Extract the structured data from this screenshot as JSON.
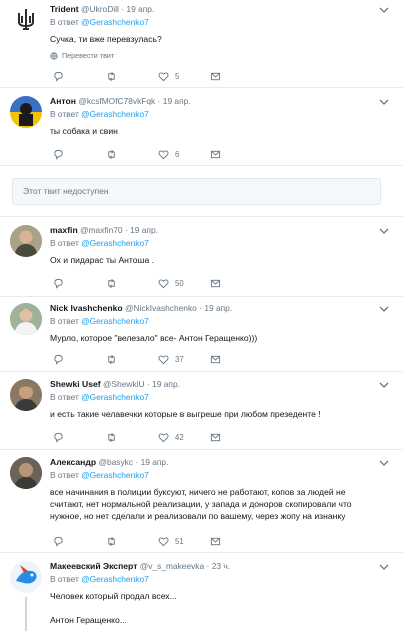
{
  "reply_prefix": "В ответ",
  "translate_label": "Перевести твит",
  "unavailable_text": "Этот твит недоступен",
  "tweets": [
    {
      "name": "Trident",
      "handle": "@UkroDill",
      "date": "19 апр.",
      "mention": "@Gerashchenko7",
      "text": "Сучка, ти вже перевзулась?",
      "replies": "",
      "retweets": "",
      "likes": "5"
    },
    {
      "name": "Антон",
      "handle": "@kcsfMOfC78vkFqk",
      "date": "19 апр.",
      "mention": "@Gerashchenko7",
      "text": "ты собака и свин",
      "replies": "",
      "retweets": "",
      "likes": "6"
    },
    {
      "name": "maxfin",
      "handle": "@maxfin70",
      "date": "19 апр.",
      "mention": "@Gerashchenko7",
      "text": "Ох и пидарас ты Антоша .",
      "replies": "",
      "retweets": "",
      "likes": "50"
    },
    {
      "name": "Nick Ivashchenko",
      "handle": "@NickIvashchenko",
      "date": "19 апр.",
      "mention": "@Gerashchenko7",
      "text": "Мурло, которое \"велезало\" все- Антон Геращенко)))",
      "replies": "",
      "retweets": "",
      "likes": "37"
    },
    {
      "name": "Shewki Usef",
      "handle": "@ShewkiU",
      "date": "19 апр.",
      "mention": "@Gerashchenko7",
      "text": "и есть такие челавечки которые в выгреше при любом презеденте !",
      "replies": "",
      "retweets": "",
      "likes": "42"
    },
    {
      "name": "Александр",
      "handle": "@basykc",
      "date": "19 апр.",
      "mention": "@Gerashchenko7",
      "text": "все начинания в полиции буксуют, ничего не работают, копов за людей не считают, нет нормальной реализации, у запада и доноров скопировали что нужное, но нет сделали и реализовали по вашему, через жопу на изнанку",
      "replies": "",
      "retweets": "",
      "likes": "51"
    },
    {
      "name": "Макеевский Эксперт",
      "handle": "@v_s_makeevka",
      "date": "23 ч.",
      "mention": "@Gerashchenko7",
      "text": "Человек который продал всех...",
      "text2": "Антон Геращенко...",
      "replies": "",
      "retweets": "",
      "likes": ""
    }
  ],
  "colors": {
    "accent": "#1da1f2",
    "muted": "#657786",
    "border": "#e6ecf0",
    "text": "#14171a"
  }
}
